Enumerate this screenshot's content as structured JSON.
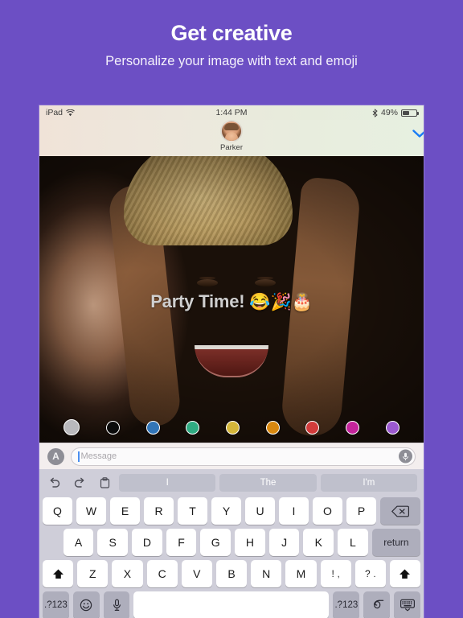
{
  "promo": {
    "title": "Get creative",
    "subtitle": "Personalize your image with text and emoji",
    "background_color": "#6c4fc4",
    "text_color": "#ffffff"
  },
  "status_bar": {
    "device_label": "iPad",
    "wifi_icon": "wifi-icon",
    "time": "1:44 PM",
    "bluetooth_icon": "bluetooth-icon",
    "battery_percent": "49%",
    "battery_icon": "battery-icon"
  },
  "conversation_header": {
    "contact_name": "Parker",
    "avatar_icon": "avatar",
    "collapse_icon": "chevron-down-icon",
    "collapse_icon_color": "#1a7cf5"
  },
  "photo": {
    "overlay_text": "Party Time!",
    "overlay_emoji": "😂🎉🎂",
    "overlay_text_color": "#cfcfcf",
    "description": "selfie of three smiling women outdoors"
  },
  "color_palette": {
    "selected_index": 0,
    "swatches": [
      {
        "name": "gray",
        "hex": "#b9b9bd",
        "selected": true
      },
      {
        "name": "black",
        "hex": "#0b0b0b",
        "selected": false
      },
      {
        "name": "blue",
        "hex": "#3175b8",
        "selected": false
      },
      {
        "name": "green",
        "hex": "#2fab82",
        "selected": false
      },
      {
        "name": "yellow",
        "hex": "#d4b63a",
        "selected": false
      },
      {
        "name": "orange",
        "hex": "#d9880f",
        "selected": false
      },
      {
        "name": "red",
        "hex": "#d23b3b",
        "selected": false
      },
      {
        "name": "magenta",
        "hex": "#c4249b",
        "selected": false
      },
      {
        "name": "purple",
        "hex": "#9b59d0",
        "selected": false
      }
    ]
  },
  "message_bar": {
    "app_drawer_icon": "appstore-icon",
    "app_drawer_label": "A",
    "input_value": "",
    "input_placeholder": "Message",
    "mic_icon": "microphone-icon"
  },
  "keyboard": {
    "predictive": {
      "undo_icon": "undo-icon",
      "redo_icon": "redo-icon",
      "paste_icon": "paste-icon",
      "suggestions": [
        "I",
        "The",
        "I'm"
      ]
    },
    "row1": [
      "Q",
      "W",
      "E",
      "R",
      "T",
      "Y",
      "U",
      "I",
      "O",
      "P"
    ],
    "backspace_icon": "backspace-icon",
    "row2": [
      "A",
      "S",
      "D",
      "F",
      "G",
      "H",
      "J",
      "K",
      "L"
    ],
    "return_label": "return",
    "row3": [
      "Z",
      "X",
      "C",
      "V",
      "B",
      "N",
      "M"
    ],
    "shift_left_icon": "shift-icon",
    "shift_right_icon": "shift-icon",
    "punct_excl": "!",
    "punct_comma": ",",
    "punct_quest": "?",
    "punct_period": ".",
    "numeric_left_label": ".?123",
    "numeric_right_label": ".?123",
    "emoji_icon": "emoji-icon",
    "dictation_icon": "microphone-icon",
    "space_label": "",
    "handwriting_icon": "handwriting-icon",
    "dismiss_keyboard_icon": "keyboard-dismiss-icon"
  }
}
